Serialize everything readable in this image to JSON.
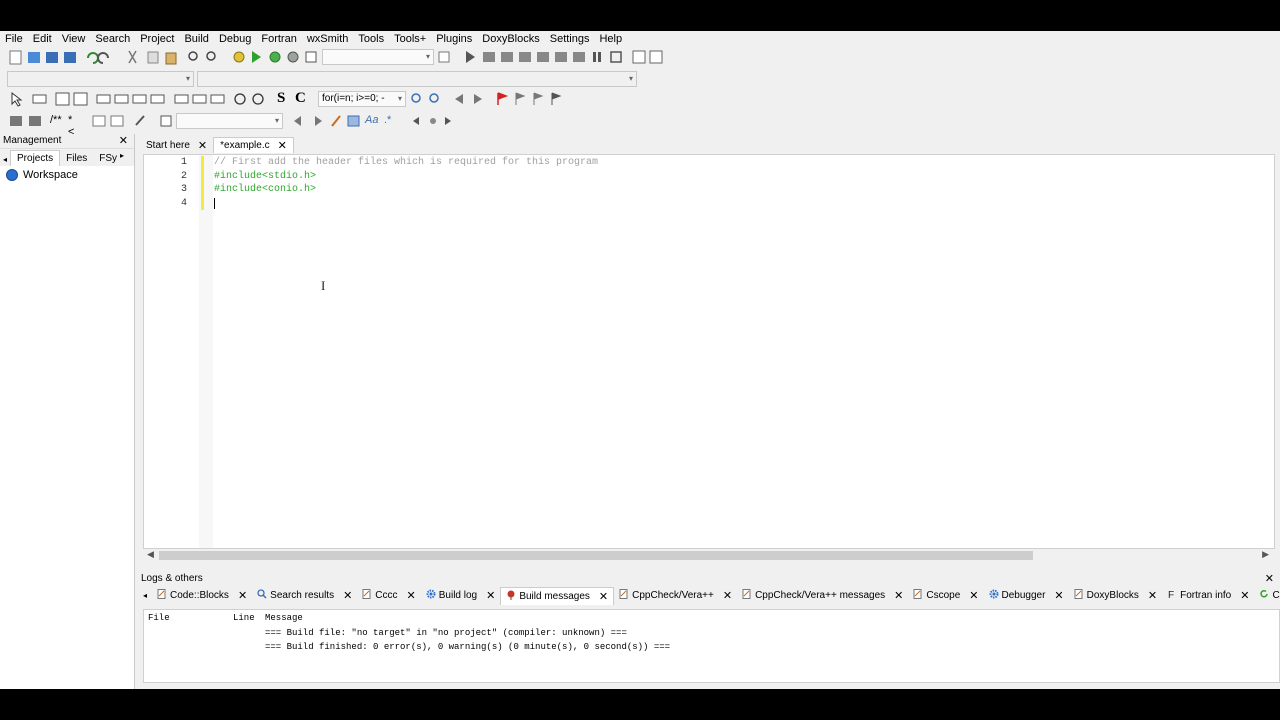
{
  "menu": [
    "File",
    "Edit",
    "View",
    "Search",
    "Project",
    "Build",
    "Debug",
    "Fortran",
    "wxSmith",
    "Tools",
    "Tools+",
    "Plugins",
    "DoxyBlocks",
    "Settings",
    "Help"
  ],
  "toolbar": {
    "search_combo_value": "for(i=n; i>=0; -",
    "bold_s": "S",
    "bold_c": "C",
    "comment_btn": "/**",
    "uncomment_btn": "*<",
    "regex_btn": "Aa",
    "regex_dot": ".*"
  },
  "management": {
    "title": "Management",
    "close": "✕",
    "tabs": [
      "Projects",
      "Files",
      "FSy"
    ],
    "workspace": "Workspace"
  },
  "editor": {
    "tabs": [
      {
        "label": "Start here",
        "close": "✕"
      },
      {
        "label": "*example.c",
        "close": "✕"
      }
    ],
    "lines": [
      {
        "num": "1",
        "text": "// First add the header files which is required for this program",
        "kind": "comment"
      },
      {
        "num": "2",
        "text": "#include<stdio.h>",
        "kind": "pp"
      },
      {
        "num": "3",
        "text": "#include<conio.h>",
        "kind": "pp"
      },
      {
        "num": "4",
        "text": "",
        "kind": "plain"
      }
    ]
  },
  "logs": {
    "title": "Logs & others",
    "close": "✕",
    "tabs": [
      {
        "label": "Code::Blocks",
        "icon": "page-icon"
      },
      {
        "label": "Search results",
        "icon": "search-icon"
      },
      {
        "label": "Cccc",
        "icon": "page-icon"
      },
      {
        "label": "Build log",
        "icon": "gear-icon"
      },
      {
        "label": "Build messages",
        "icon": "pin-icon"
      },
      {
        "label": "CppCheck/Vera++",
        "icon": "page-icon"
      },
      {
        "label": "CppCheck/Vera++ messages",
        "icon": "page-icon"
      },
      {
        "label": "Cscope",
        "icon": "page-icon"
      },
      {
        "label": "Debugger",
        "icon": "gear-icon"
      },
      {
        "label": "DoxyBlocks",
        "icon": "page-icon"
      },
      {
        "label": "Fortran info",
        "icon": "f-icon"
      },
      {
        "label": "Closed",
        "icon": "refresh-icon"
      }
    ],
    "headers": {
      "file": "File",
      "line": "Line",
      "message": "Message"
    },
    "messages": [
      "=== Build file: \"no target\" in \"no project\" (compiler: unknown) ===",
      "=== Build finished: 0 error(s), 0 warning(s) (0 minute(s), 0 second(s)) ==="
    ]
  },
  "colors": {
    "comment": "#a0a0a0",
    "preprocessor": "#2fa82f",
    "changed_line_marker": "#f4e842"
  }
}
